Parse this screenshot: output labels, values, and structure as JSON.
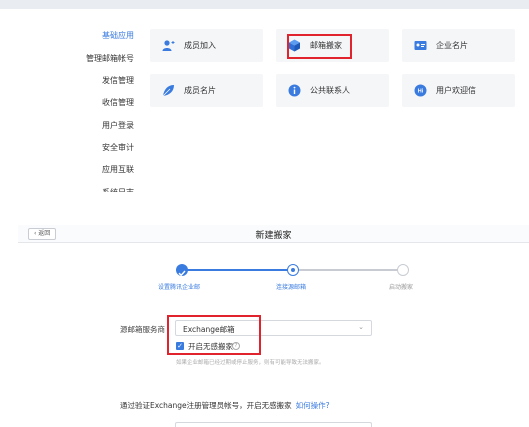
{
  "sidebar": {
    "items": [
      {
        "label": "基础应用",
        "active": true
      },
      {
        "label": "管理邮箱帐号",
        "active": false
      },
      {
        "label": "发信管理",
        "active": false
      },
      {
        "label": "收信管理",
        "active": false
      },
      {
        "label": "用户登录",
        "active": false
      },
      {
        "label": "安全审计",
        "active": false
      },
      {
        "label": "应用互联",
        "active": false
      },
      {
        "label": "系统日志",
        "active": false
      }
    ]
  },
  "apps": {
    "tiles": [
      {
        "label": "成员加入",
        "icon": "user-add-icon"
      },
      {
        "label": "邮箱搬家",
        "icon": "cube-icon"
      },
      {
        "label": "企业名片",
        "icon": "business-card-icon"
      },
      {
        "label": "成员名片",
        "icon": "leaf-icon"
      },
      {
        "label": "公共联系人",
        "icon": "info-icon"
      },
      {
        "label": "用户欢迎信",
        "icon": "welcome-letter-icon"
      }
    ],
    "welcome_icon_text": "Hi"
  },
  "migration": {
    "back_label": "‹ 返回",
    "title": "新建搬家",
    "steps": [
      {
        "label": "设置腾讯企业邮",
        "state": "done"
      },
      {
        "label": "连接源邮箱",
        "state": "current"
      },
      {
        "label": "启动搬家",
        "state": "pending"
      }
    ],
    "provider_label": "源邮箱服务商",
    "provider_value": "Exchange邮箱",
    "seamless_label": "开启无感搬家",
    "seamless_checked": true,
    "hint": "如果企业邮箱已经过期或停止服务，则有可能导致无法搬家。",
    "section_text": "通过验证Exchange注册管理员帐号，开启无感搬家",
    "section_link": "如何操作?"
  },
  "colors": {
    "accent": "#3a7be0",
    "highlight": "#e0232c",
    "step_pending": "#c8ccd2"
  }
}
